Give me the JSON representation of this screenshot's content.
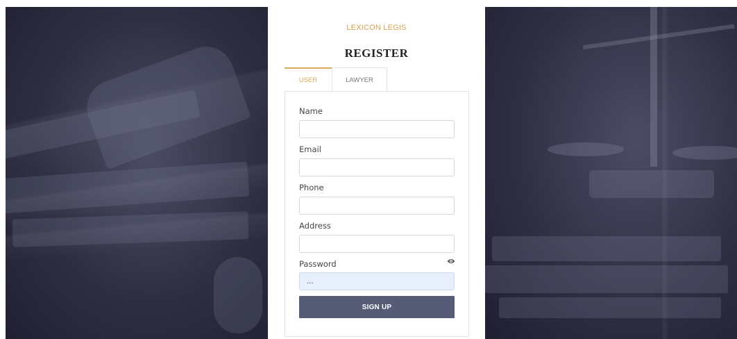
{
  "brand": "LEXICON LEGIS",
  "title": "REGISTER",
  "tabs": [
    {
      "label": "USER",
      "active": true
    },
    {
      "label": "LAWYER",
      "active": false
    }
  ],
  "form": {
    "name_label": "Name",
    "name_value": "",
    "email_label": "Email",
    "email_value": "",
    "phone_label": "Phone",
    "phone_value": "",
    "address_label": "Address",
    "address_value": "",
    "password_label": "Password",
    "password_value": "...",
    "password_toggle_icon": "eye-icon",
    "submit_label": "SIGN UP"
  },
  "colors": {
    "accent": "#d4a04e",
    "button": "#565b76",
    "password_fill": "#e8effc",
    "photo_tint": "#2e2f42"
  }
}
